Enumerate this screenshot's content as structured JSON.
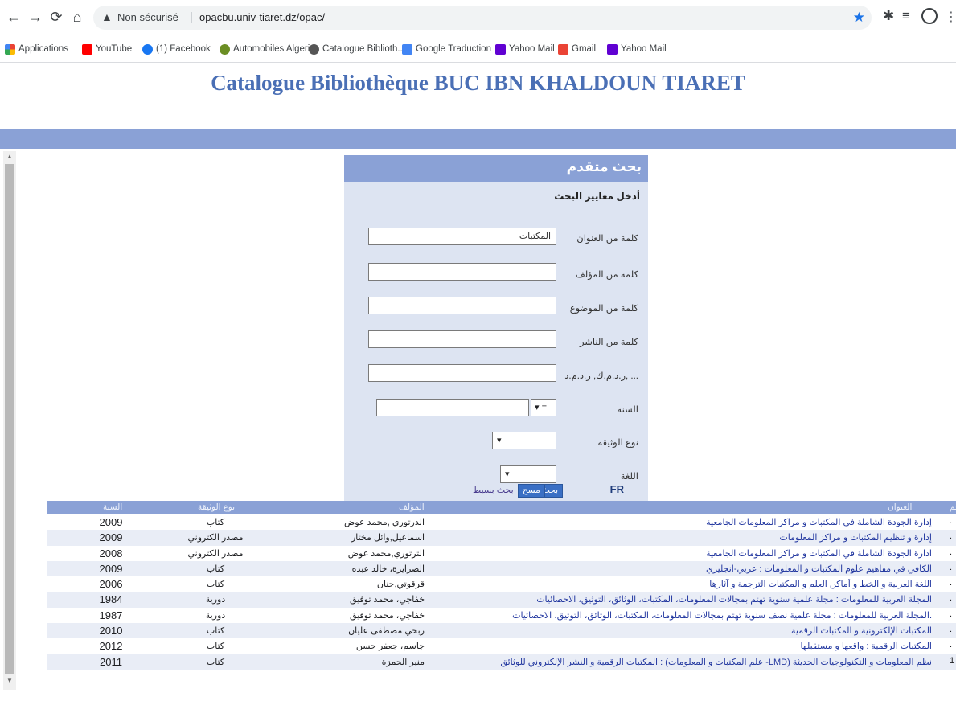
{
  "browser": {
    "security_label": "Non sécurisé",
    "url": "opacbu.univ-tiaret.dz/opac/"
  },
  "bookmarks": [
    {
      "label": "Applications",
      "icon": "apps-grid-icon",
      "color": "#e8453c"
    },
    {
      "label": "YouTube",
      "icon": "youtube-icon",
      "color": "#ff0000"
    },
    {
      "label": "(1) Facebook",
      "icon": "facebook-icon",
      "color": "#1877f2"
    },
    {
      "label": "Automobiles Algerie",
      "icon": "site-icon",
      "color": "#6b8e23"
    },
    {
      "label": "Catalogue Biblioth...",
      "icon": "globe-icon",
      "color": "#555555"
    },
    {
      "label": "Google Traduction",
      "icon": "translate-icon",
      "color": "#4285f4"
    },
    {
      "label": "Yahoo Mail",
      "icon": "yahoo-mail-icon",
      "color": "#6001d2"
    },
    {
      "label": "Gmail",
      "icon": "gmail-icon",
      "color": "#ea4335"
    },
    {
      "label": "Yahoo Mail",
      "icon": "yahoo-mail-icon",
      "color": "#6001d2"
    }
  ],
  "page": {
    "title": "Catalogue Bibliothèque BUC IBN KHALDOUN TIARET"
  },
  "search": {
    "heading": "بحث متقدم",
    "subheading": "أدخل معايير البحث",
    "fields": {
      "title_label": "كلمة من العنوان",
      "title_value": "المكتبات",
      "author_label": "كلمة من المؤلف",
      "author_value": "",
      "subject_label": "كلمة من الموضوع",
      "subject_value": "",
      "publisher_label": "كلمة من الناشر",
      "publisher_value": "",
      "isbn_label": "ر.د.م.ك, ر.د.م.د, ...",
      "isbn_value": "",
      "year_label": "السنة",
      "year_operator": "=",
      "year_value": "",
      "doctype_label": "نوع الوثيقة",
      "language_label": "اللغة"
    },
    "buttons": {
      "search": "بحث",
      "clear": "مسح",
      "simple": "بحث بسيط",
      "lang": "FR"
    }
  },
  "results": {
    "columns": {
      "year": "السنة",
      "type": "نوع الوثيقة",
      "author": "المؤلف",
      "title": "العنوان",
      "num": "قم"
    },
    "rows": [
      {
        "year": "2009",
        "type": "كتاب",
        "author": "الدرتوري ,محمد عوض",
        "title": "إدارة الجودة الشاملة في المكتبات و مراكز المعلومات الجامعية",
        "num": "."
      },
      {
        "year": "2009",
        "type": "مصدر الكتروني",
        "author": "اسماعيل,وائل مختار",
        "title": "إدارة و تنظيم المكتبات و مراكز المعلومات",
        "num": "."
      },
      {
        "year": "2008",
        "type": "مصدر الكتروني",
        "author": "الترتوري,محمد عوض",
        "title": "ادارة الجودة الشاملة في المكتبات و مراكز المعلومات الجامعية",
        "num": "."
      },
      {
        "year": "2009",
        "type": "كتاب",
        "author": "الصرايرة، خالد عبده",
        "title": "الكافي في مفاهيم علوم المكتبات و المعلومات : عربي-انجليزي",
        "num": "."
      },
      {
        "year": "2006",
        "type": "كتاب",
        "author": "قرقوتي,حنان",
        "title": "اللغة العربية و الخط و أماكن العلم و المكتبات الترجمة و آثارها",
        "num": "."
      },
      {
        "year": "1984",
        "type": "دورية",
        "author": "خفاجي، محمد توفيق",
        "title": "المجلة العربية للمعلومات : مجلة علمية سنوية تهتم بمجالات المعلومات، المكتبات، الوثائق، التوثيق، الاحصائيات",
        "num": "."
      },
      {
        "year": "1987",
        "type": "دورية",
        "author": "خفاجي، محمد توفيق",
        "title": "المجلة العربية للمعلومات : مجلة علمية نصف سنوية تهتم بمجالات المعلومات، المكتبات، الوثائق، التوثيق، الاحصائيات.",
        "num": "."
      },
      {
        "year": "2010",
        "type": "كتاب",
        "author": "ربحي مصطفى عليان",
        "title": "المكتبات الإلكترونية و المكتبات الرقمية",
        "num": "."
      },
      {
        "year": "2012",
        "type": "كتاب",
        "author": "جاسم، جعفر حسن",
        "title": "المكتبات الرقمية : واقعها و مستقبلها",
        "num": "."
      },
      {
        "year": "2011",
        "type": "كتاب",
        "author": "منير الحمزة",
        "title": "المكتبات الرقمية و النشر الإلكتروني للوثائق : (علم المكتبات و المعلومات -LMD) نظم المعلومات و التكنولوجيات الحديثة",
        "num": "1"
      }
    ]
  }
}
